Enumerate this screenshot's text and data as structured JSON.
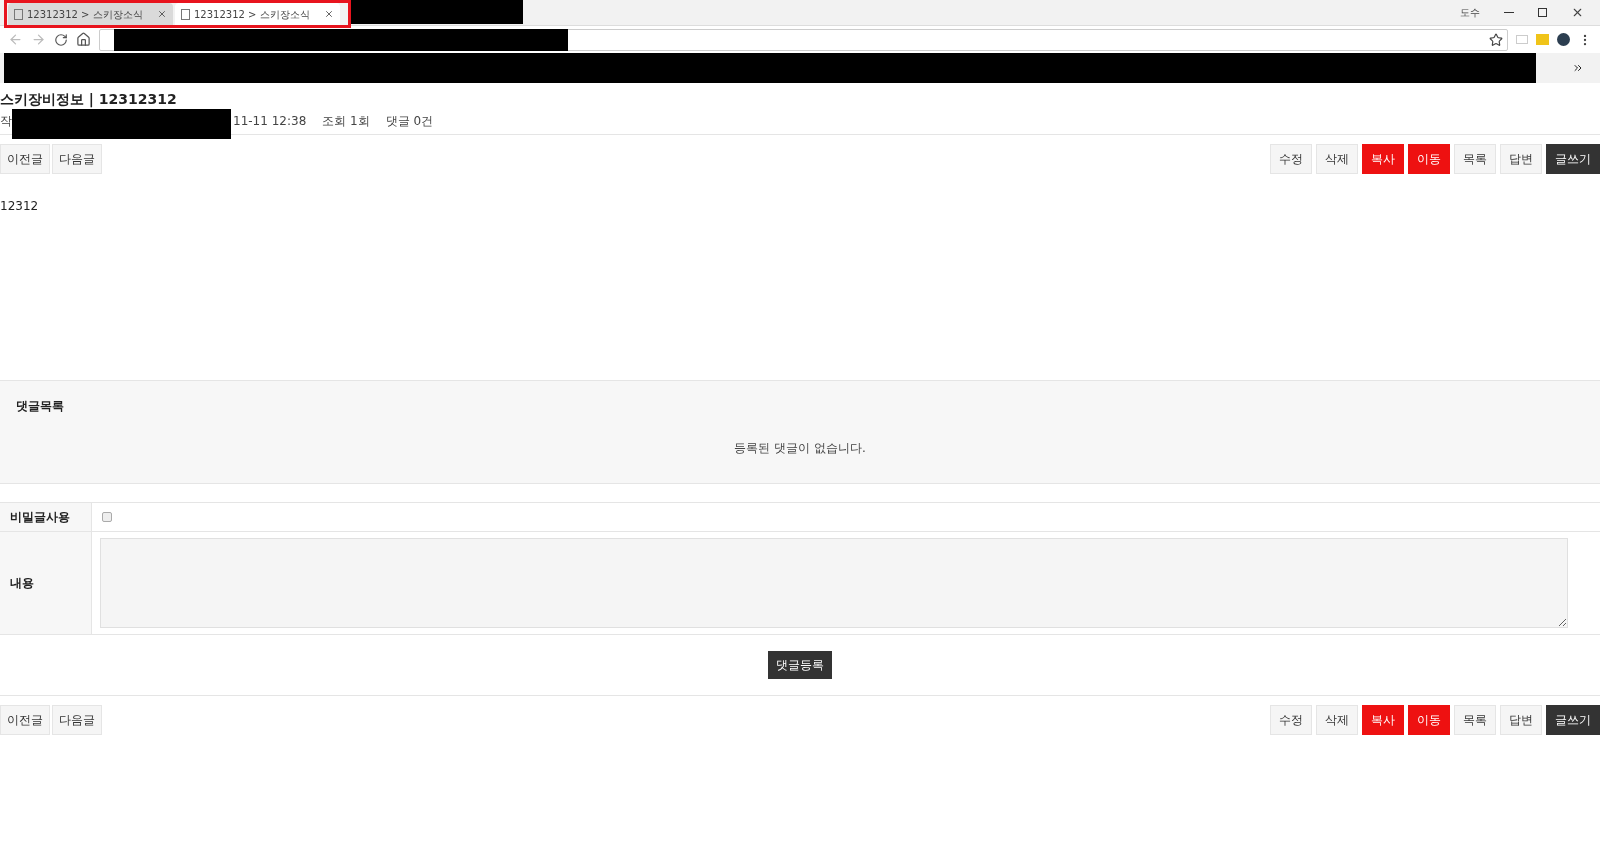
{
  "browser": {
    "tabs": [
      {
        "title": "12312312 > 스키장소식",
        "selected": false
      },
      {
        "title": "12312312 > 스키장소식",
        "selected": true
      }
    ],
    "profile": "도수"
  },
  "post": {
    "title": "스키장비정보 | 12312312",
    "author_label": "작",
    "date": "11-11 12:38",
    "views": "조회 1회",
    "comments": "댓글 0건",
    "body": "12312"
  },
  "top_bar": {
    "nav_buttons": [
      "이전글",
      "다음글"
    ],
    "action_buttons": [
      {
        "label": "수정",
        "kind": "plain"
      },
      {
        "label": "삭제",
        "kind": "plain"
      },
      {
        "label": "복사",
        "kind": "danger"
      },
      {
        "label": "이동",
        "kind": "danger"
      },
      {
        "label": "목록",
        "kind": "plain"
      },
      {
        "label": "답변",
        "kind": "plain"
      },
      {
        "label": "글쓰기",
        "kind": "dark"
      }
    ]
  },
  "bottom_bar": {
    "nav_buttons": [
      "이전글",
      "다음글"
    ],
    "action_buttons": [
      {
        "label": "수정",
        "kind": "plain"
      },
      {
        "label": "삭제",
        "kind": "plain"
      },
      {
        "label": "복사",
        "kind": "danger"
      },
      {
        "label": "이동",
        "kind": "danger"
      },
      {
        "label": "목록",
        "kind": "plain"
      },
      {
        "label": "답변",
        "kind": "plain"
      },
      {
        "label": "글쓰기",
        "kind": "dark"
      }
    ]
  },
  "comment_list": {
    "title": "댓글목록",
    "empty": "등록된 댓글이 없습니다."
  },
  "comment_form": {
    "secret_label": "비밀글사용",
    "secret_checked": false,
    "content_label": "내용",
    "submit": "댓글등록"
  }
}
